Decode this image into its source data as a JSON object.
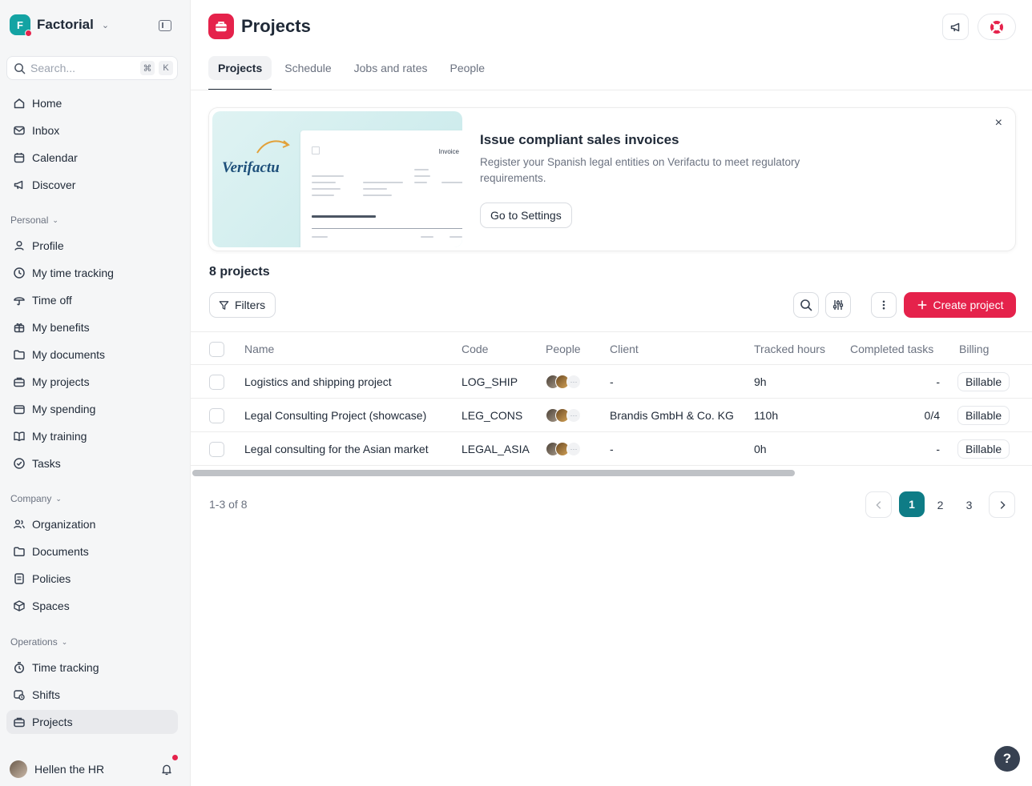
{
  "sidebar": {
    "brand": "Factorial",
    "brand_initial": "F",
    "search_placeholder": "Search...",
    "shortcut": [
      "⌘",
      "K"
    ],
    "main_items": [
      {
        "label": "Home",
        "icon": "home-icon"
      },
      {
        "label": "Inbox",
        "icon": "inbox-icon"
      },
      {
        "label": "Calendar",
        "icon": "calendar-icon"
      },
      {
        "label": "Discover",
        "icon": "megaphone-icon"
      }
    ],
    "personal": {
      "title": "Personal",
      "items": [
        {
          "label": "Profile",
          "icon": "person-icon"
        },
        {
          "label": "My time tracking",
          "icon": "clock-icon"
        },
        {
          "label": "Time off",
          "icon": "umbrella-icon"
        },
        {
          "label": "My benefits",
          "icon": "gift-icon"
        },
        {
          "label": "My documents",
          "icon": "folder-icon"
        },
        {
          "label": "My projects",
          "icon": "briefcase-icon"
        },
        {
          "label": "My spending",
          "icon": "wallet-icon"
        },
        {
          "label": "My training",
          "icon": "book-icon"
        },
        {
          "label": "Tasks",
          "icon": "check-circle-icon"
        }
      ]
    },
    "company": {
      "title": "Company",
      "items": [
        {
          "label": "Organization",
          "icon": "people-icon"
        },
        {
          "label": "Documents",
          "icon": "documents-icon"
        },
        {
          "label": "Policies",
          "icon": "policy-icon"
        },
        {
          "label": "Spaces",
          "icon": "cube-icon"
        }
      ]
    },
    "operations": {
      "title": "Operations",
      "items": [
        {
          "label": "Time tracking",
          "icon": "stopwatch-icon"
        },
        {
          "label": "Shifts",
          "icon": "shifts-icon"
        },
        {
          "label": "Projects",
          "icon": "briefcase-icon",
          "active": true
        }
      ]
    },
    "user": {
      "name": "Hellen the HR"
    }
  },
  "header": {
    "title": "Projects",
    "tabs": [
      {
        "label": "Projects",
        "active": true
      },
      {
        "label": "Schedule"
      },
      {
        "label": "Jobs and rates"
      },
      {
        "label": "People"
      }
    ]
  },
  "banner": {
    "title": "Issue compliant sales invoices",
    "description": "Register your Spanish legal entities on Verifactu to meet regulatory requirements.",
    "button": "Go to Settings",
    "close": "×",
    "image_logo": "Verifactu",
    "invoice_label": "Invoice"
  },
  "toolbar": {
    "count": "8 projects",
    "filters": "Filters",
    "create": "Create project"
  },
  "table": {
    "columns": [
      "Name",
      "Code",
      "People",
      "Client",
      "Tracked hours",
      "Completed tasks",
      "Billing"
    ],
    "rows": [
      {
        "name": "Logistics and shipping project",
        "code": "LOG_SHIP",
        "client": "-",
        "hours": "9h",
        "tasks": "-",
        "billing": "Billable"
      },
      {
        "name": "Legal Consulting Project (showcase)",
        "code": "LEG_CONS",
        "client": "Brandis GmbH & Co. KG",
        "hours": "110h",
        "tasks": "0/4",
        "billing": "Billable"
      },
      {
        "name": "Legal consulting for the Asian market",
        "code": "LEGAL_ASIA",
        "client": "-",
        "hours": "0h",
        "tasks": "-",
        "billing": "Billable"
      }
    ],
    "more_people": "···"
  },
  "pagination": {
    "range": "1-3 of 8",
    "pages": [
      "1",
      "2",
      "3"
    ],
    "current": "1"
  },
  "help": "?",
  "colors": {
    "brand_teal": "#14a3a3",
    "primary_red": "#e5224b",
    "page_current": "#0e7c86"
  }
}
